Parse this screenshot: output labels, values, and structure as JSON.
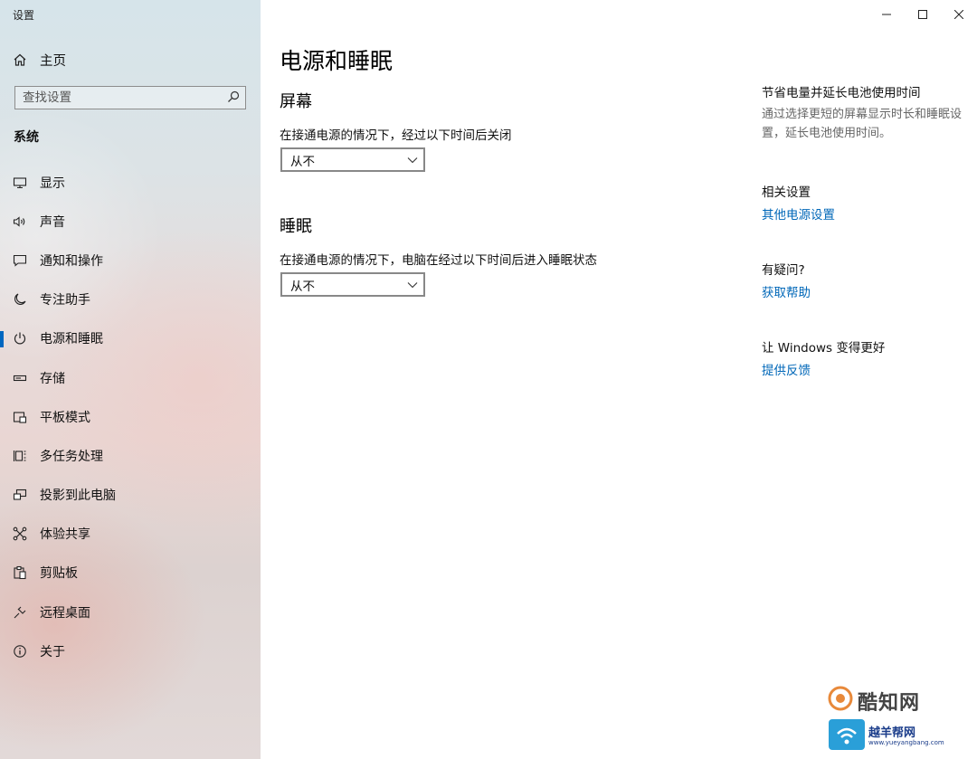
{
  "window": {
    "title": "设置"
  },
  "sidebar": {
    "home_label": "主页",
    "search_placeholder": "查找设置",
    "section": "系统",
    "items": [
      {
        "label": "显示",
        "icon": "monitor-icon"
      },
      {
        "label": "声音",
        "icon": "speaker-icon"
      },
      {
        "label": "通知和操作",
        "icon": "message-icon"
      },
      {
        "label": "专注助手",
        "icon": "moon-icon"
      },
      {
        "label": "电源和睡眠",
        "icon": "power-icon",
        "active": true
      },
      {
        "label": "存储",
        "icon": "storage-icon"
      },
      {
        "label": "平板模式",
        "icon": "tablet-icon"
      },
      {
        "label": "多任务处理",
        "icon": "multitask-icon"
      },
      {
        "label": "投影到此电脑",
        "icon": "project-icon"
      },
      {
        "label": "体验共享",
        "icon": "share-icon"
      },
      {
        "label": "剪贴板",
        "icon": "clipboard-icon"
      },
      {
        "label": "远程桌面",
        "icon": "remote-icon"
      },
      {
        "label": "关于",
        "icon": "info-icon"
      }
    ]
  },
  "main": {
    "title": "电源和睡眠",
    "screen": {
      "heading": "屏幕",
      "desc": "在接通电源的情况下，经过以下时间后关闭",
      "value": "从不"
    },
    "sleep": {
      "heading": "睡眠",
      "desc": "在接通电源的情况下，电脑在经过以下时间后进入睡眠状态",
      "value": "从不"
    }
  },
  "right": {
    "tip_heading": "节省电量并延长电池使用时间",
    "tip_text": "通过选择更短的屏幕显示时长和睡眠设置，延长电池使用时间。",
    "related_heading": "相关设置",
    "related_link": "其他电源设置",
    "question_heading": "有疑问?",
    "question_link": "获取帮助",
    "feedback_heading": "让 Windows 变得更好",
    "feedback_link": "提供反馈"
  },
  "watermark": {
    "line1": "酷知网",
    "line2": "越羊帮网",
    "line3": "www.yueyangbang.com"
  },
  "colors": {
    "accent": "#0067c0",
    "link": "#0067b8"
  }
}
